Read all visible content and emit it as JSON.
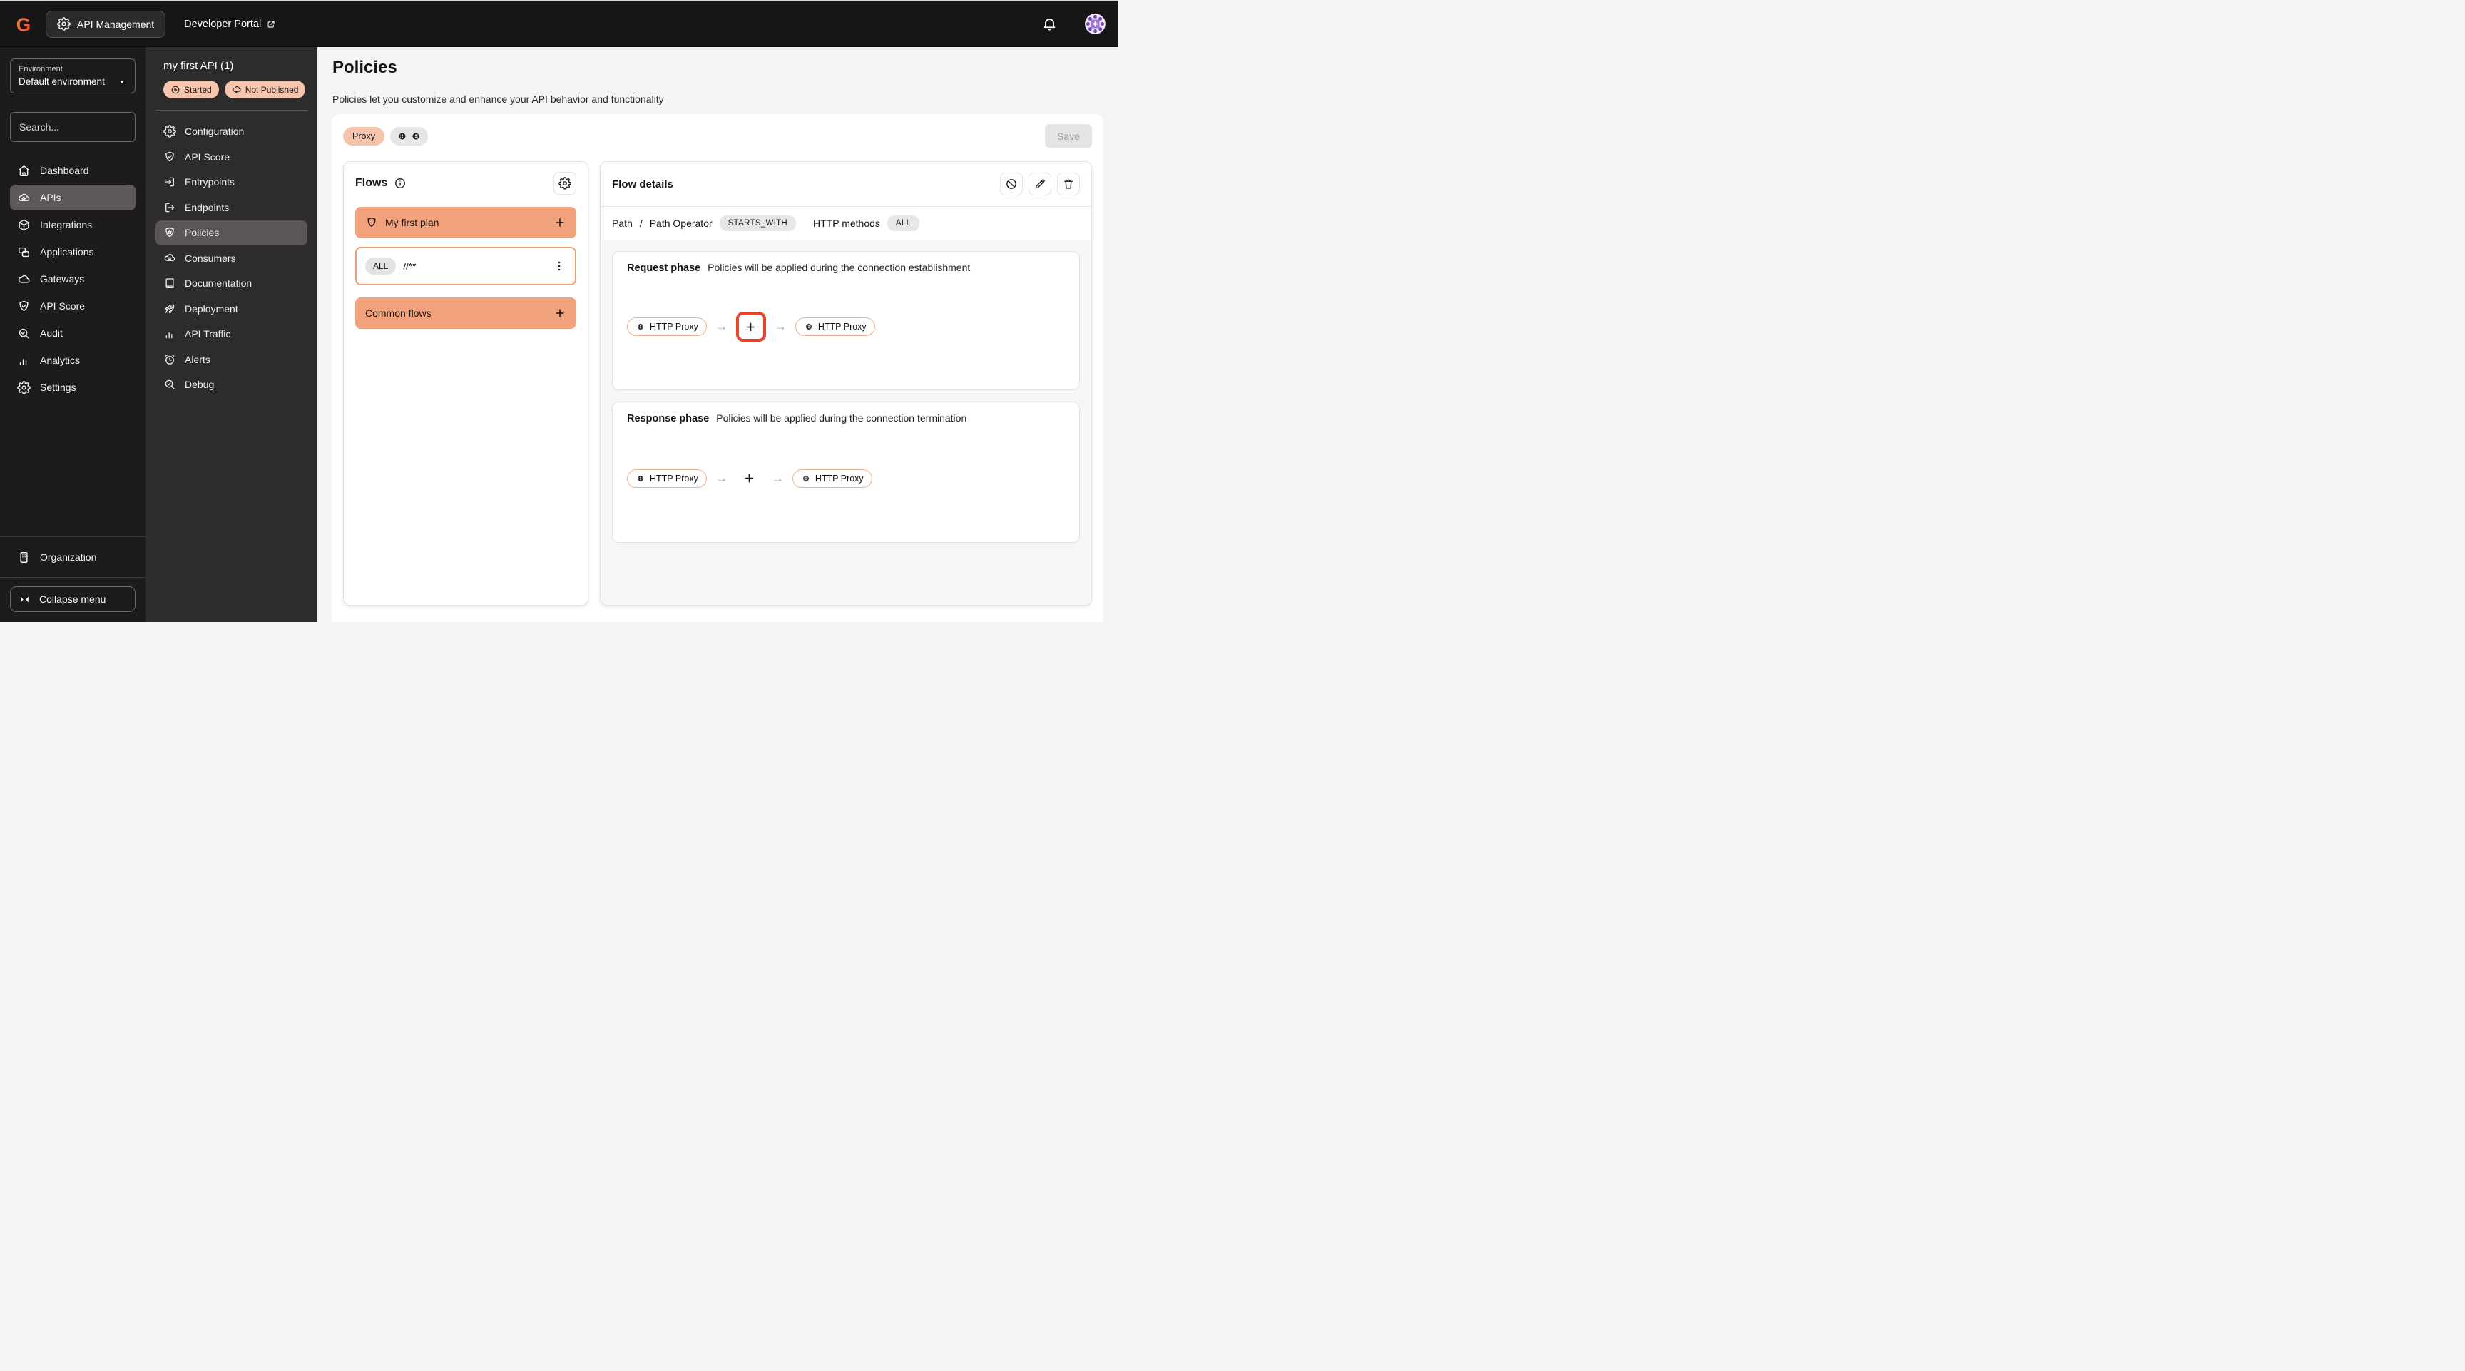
{
  "topbar": {
    "app_name": "API Management",
    "portal_label": "Developer Portal"
  },
  "sidebar": {
    "environment": {
      "label": "Environment",
      "value": "Default environment"
    },
    "search_placeholder": "Search...",
    "items": [
      {
        "label": "Dashboard"
      },
      {
        "label": "APIs"
      },
      {
        "label": "Integrations"
      },
      {
        "label": "Applications"
      },
      {
        "label": "Gateways"
      },
      {
        "label": "API Score"
      },
      {
        "label": "Audit"
      },
      {
        "label": "Analytics"
      },
      {
        "label": "Settings"
      }
    ],
    "organization_label": "Organization",
    "collapse_label": "Collapse menu"
  },
  "api_menu": {
    "title": "my first API (1)",
    "badges": [
      {
        "label": "Started"
      },
      {
        "label": "Not Published"
      }
    ],
    "items": [
      {
        "label": "Configuration"
      },
      {
        "label": "API Score"
      },
      {
        "label": "Entrypoints"
      },
      {
        "label": "Endpoints"
      },
      {
        "label": "Policies"
      },
      {
        "label": "Consumers"
      },
      {
        "label": "Documentation"
      },
      {
        "label": "Deployment"
      },
      {
        "label": "API Traffic"
      },
      {
        "label": "Alerts"
      },
      {
        "label": "Debug"
      }
    ]
  },
  "main": {
    "title": "Policies",
    "description": "Policies let you customize and enhance your API behavior and functionality",
    "proxy_chip": "Proxy",
    "save_label": "Save",
    "flows": {
      "title": "Flows",
      "plan_label": "My first plan",
      "flow_row": {
        "method": "ALL",
        "path": "//**"
      },
      "common_label": "Common flows"
    },
    "details": {
      "title": "Flow details",
      "condition": {
        "path_label": "Path",
        "path_value": "/",
        "operator_label": "Path Operator",
        "operator_value": "STARTS_WITH",
        "methods_label": "HTTP methods",
        "methods_value": "ALL"
      },
      "request": {
        "title": "Request phase",
        "description": "Policies will be applied during the connection establishment",
        "start_label": "HTTP Proxy",
        "end_label": "HTTP Proxy"
      },
      "response": {
        "title": "Response phase",
        "description": "Policies will be applied during the connection termination",
        "start_label": "HTTP Proxy",
        "end_label": "HTTP Proxy"
      }
    }
  },
  "colors": {
    "accent_orange": "#f0a27d",
    "badge_peach": "#f6c5ae",
    "highlight_red": "#e8432c",
    "topbar_bg": "#171515",
    "sidebar_bg": "#1d1b1b",
    "api_menu_bg": "#2e2b2b"
  }
}
